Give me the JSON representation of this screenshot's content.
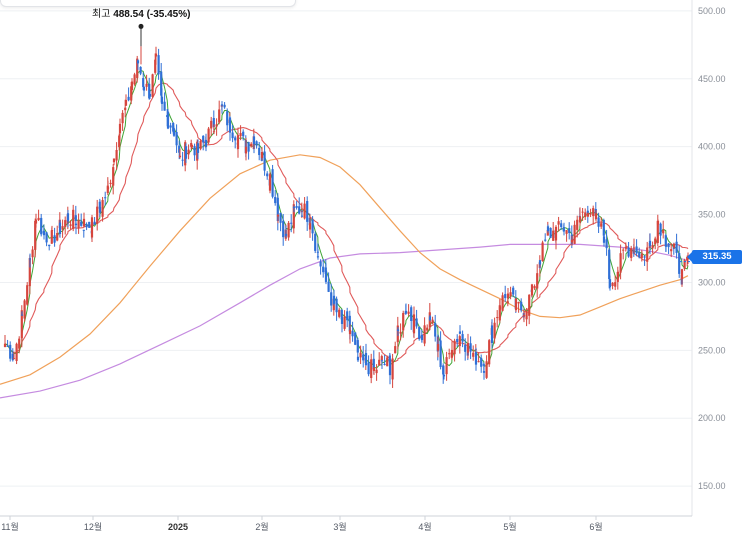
{
  "chart_data": {
    "type": "candlestick",
    "y_axis": {
      "ticks": [
        "500.00",
        "450.00",
        "400.00",
        "350.00",
        "300.00",
        "250.00",
        "200.00",
        "150.00"
      ],
      "tick_values": [
        500,
        450,
        400,
        350,
        300,
        250,
        200,
        150
      ],
      "ylim": [
        128,
        508
      ],
      "position": "right"
    },
    "x_axis": {
      "labels": [
        "11월",
        "12월",
        "2025",
        "2월",
        "3월",
        "4월",
        "5월",
        "6월"
      ],
      "bold": [
        false,
        false,
        true,
        false,
        false,
        false,
        false,
        false
      ]
    },
    "high_marker": {
      "prefix": "최고",
      "value": "488.54",
      "change": "(-35.45%)",
      "price": 488.54
    },
    "current_price": {
      "label": "315.35",
      "value": 315.35
    },
    "colors": {
      "up": "#d6453d",
      "down": "#2f6fd6",
      "ma5": "#3fa535",
      "ma20": "#e05a5a",
      "ma60": "#f0a15a",
      "ma120": "#c58be0",
      "accent": "#1a73e8"
    },
    "anchors": [
      {
        "x": 5,
        "p": 255
      },
      {
        "x": 14,
        "p": 245
      },
      {
        "x": 22,
        "p": 275
      },
      {
        "x": 30,
        "p": 315
      },
      {
        "x": 36,
        "p": 350
      },
      {
        "x": 44,
        "p": 335
      },
      {
        "x": 52,
        "p": 332
      },
      {
        "x": 60,
        "p": 340
      },
      {
        "x": 68,
        "p": 348
      },
      {
        "x": 76,
        "p": 346
      },
      {
        "x": 84,
        "p": 343
      },
      {
        "x": 92,
        "p": 342
      },
      {
        "x": 100,
        "p": 355
      },
      {
        "x": 108,
        "p": 368
      },
      {
        "x": 114,
        "p": 392
      },
      {
        "x": 120,
        "p": 418
      },
      {
        "x": 126,
        "p": 428
      },
      {
        "x": 132,
        "p": 448
      },
      {
        "x": 138,
        "p": 462
      },
      {
        "x": 144,
        "p": 445
      },
      {
        "x": 150,
        "p": 440
      },
      {
        "x": 156,
        "p": 462
      },
      {
        "x": 162,
        "p": 428
      },
      {
        "x": 168,
        "p": 420
      },
      {
        "x": 174,
        "p": 412
      },
      {
        "x": 180,
        "p": 390
      },
      {
        "x": 186,
        "p": 398
      },
      {
        "x": 192,
        "p": 402
      },
      {
        "x": 198,
        "p": 396
      },
      {
        "x": 206,
        "p": 405
      },
      {
        "x": 214,
        "p": 418
      },
      {
        "x": 222,
        "p": 428
      },
      {
        "x": 230,
        "p": 415
      },
      {
        "x": 238,
        "p": 408
      },
      {
        "x": 246,
        "p": 400
      },
      {
        "x": 254,
        "p": 408
      },
      {
        "x": 262,
        "p": 392
      },
      {
        "x": 270,
        "p": 378
      },
      {
        "x": 278,
        "p": 350
      },
      {
        "x": 286,
        "p": 335
      },
      {
        "x": 294,
        "p": 352
      },
      {
        "x": 302,
        "p": 355
      },
      {
        "x": 310,
        "p": 348
      },
      {
        "x": 318,
        "p": 320
      },
      {
        "x": 326,
        "p": 300
      },
      {
        "x": 334,
        "p": 282
      },
      {
        "x": 342,
        "p": 270
      },
      {
        "x": 350,
        "p": 265
      },
      {
        "x": 358,
        "p": 242
      },
      {
        "x": 366,
        "p": 240
      },
      {
        "x": 374,
        "p": 235
      },
      {
        "x": 382,
        "p": 242
      },
      {
        "x": 390,
        "p": 238
      },
      {
        "x": 398,
        "p": 262
      },
      {
        "x": 406,
        "p": 282
      },
      {
        "x": 414,
        "p": 270
      },
      {
        "x": 422,
        "p": 262
      },
      {
        "x": 430,
        "p": 275
      },
      {
        "x": 438,
        "p": 250
      },
      {
        "x": 444,
        "p": 232
      },
      {
        "x": 452,
        "p": 255
      },
      {
        "x": 460,
        "p": 262
      },
      {
        "x": 468,
        "p": 252
      },
      {
        "x": 476,
        "p": 245
      },
      {
        "x": 484,
        "p": 240
      },
      {
        "x": 492,
        "p": 262
      },
      {
        "x": 500,
        "p": 286
      },
      {
        "x": 508,
        "p": 290
      },
      {
        "x": 516,
        "p": 282
      },
      {
        "x": 524,
        "p": 280
      },
      {
        "x": 532,
        "p": 292
      },
      {
        "x": 540,
        "p": 318
      },
      {
        "x": 548,
        "p": 335
      },
      {
        "x": 556,
        "p": 338
      },
      {
        "x": 564,
        "p": 340
      },
      {
        "x": 572,
        "p": 333
      },
      {
        "x": 580,
        "p": 348
      },
      {
        "x": 588,
        "p": 356
      },
      {
        "x": 596,
        "p": 345
      },
      {
        "x": 604,
        "p": 335
      },
      {
        "x": 610,
        "p": 300
      },
      {
        "x": 618,
        "p": 310
      },
      {
        "x": 626,
        "p": 325
      },
      {
        "x": 634,
        "p": 326
      },
      {
        "x": 642,
        "p": 320
      },
      {
        "x": 650,
        "p": 327
      },
      {
        "x": 658,
        "p": 346
      },
      {
        "x": 666,
        "p": 332
      },
      {
        "x": 674,
        "p": 322
      },
      {
        "x": 682,
        "p": 305
      },
      {
        "x": 688,
        "p": 315.35
      }
    ],
    "ma60_anchors": [
      {
        "x": 0,
        "p": 225
      },
      {
        "x": 30,
        "p": 232
      },
      {
        "x": 60,
        "p": 245
      },
      {
        "x": 90,
        "p": 262
      },
      {
        "x": 120,
        "p": 285
      },
      {
        "x": 150,
        "p": 312
      },
      {
        "x": 180,
        "p": 338
      },
      {
        "x": 210,
        "p": 362
      },
      {
        "x": 240,
        "p": 380
      },
      {
        "x": 270,
        "p": 390
      },
      {
        "x": 300,
        "p": 394
      },
      {
        "x": 320,
        "p": 392
      },
      {
        "x": 340,
        "p": 385
      },
      {
        "x": 360,
        "p": 372
      },
      {
        "x": 380,
        "p": 355
      },
      {
        "x": 400,
        "p": 338
      },
      {
        "x": 420,
        "p": 322
      },
      {
        "x": 440,
        "p": 310
      },
      {
        "x": 460,
        "p": 302
      },
      {
        "x": 480,
        "p": 295
      },
      {
        "x": 500,
        "p": 288
      },
      {
        "x": 520,
        "p": 280
      },
      {
        "x": 540,
        "p": 275
      },
      {
        "x": 560,
        "p": 274
      },
      {
        "x": 580,
        "p": 276
      },
      {
        "x": 600,
        "p": 282
      },
      {
        "x": 620,
        "p": 288
      },
      {
        "x": 640,
        "p": 293
      },
      {
        "x": 660,
        "p": 298
      },
      {
        "x": 680,
        "p": 302
      },
      {
        "x": 688,
        "p": 305
      }
    ],
    "ma120_anchors": [
      {
        "x": 0,
        "p": 215
      },
      {
        "x": 40,
        "p": 220
      },
      {
        "x": 80,
        "p": 228
      },
      {
        "x": 120,
        "p": 240
      },
      {
        "x": 160,
        "p": 254
      },
      {
        "x": 200,
        "p": 268
      },
      {
        "x": 240,
        "p": 285
      },
      {
        "x": 270,
        "p": 298
      },
      {
        "x": 300,
        "p": 310
      },
      {
        "x": 330,
        "p": 318
      },
      {
        "x": 360,
        "p": 321
      },
      {
        "x": 400,
        "p": 322
      },
      {
        "x": 440,
        "p": 324
      },
      {
        "x": 480,
        "p": 326
      },
      {
        "x": 510,
        "p": 328
      },
      {
        "x": 540,
        "p": 328
      },
      {
        "x": 580,
        "p": 328
      },
      {
        "x": 620,
        "p": 326
      },
      {
        "x": 650,
        "p": 323
      },
      {
        "x": 670,
        "p": 320
      },
      {
        "x": 688,
        "p": 316
      }
    ]
  }
}
